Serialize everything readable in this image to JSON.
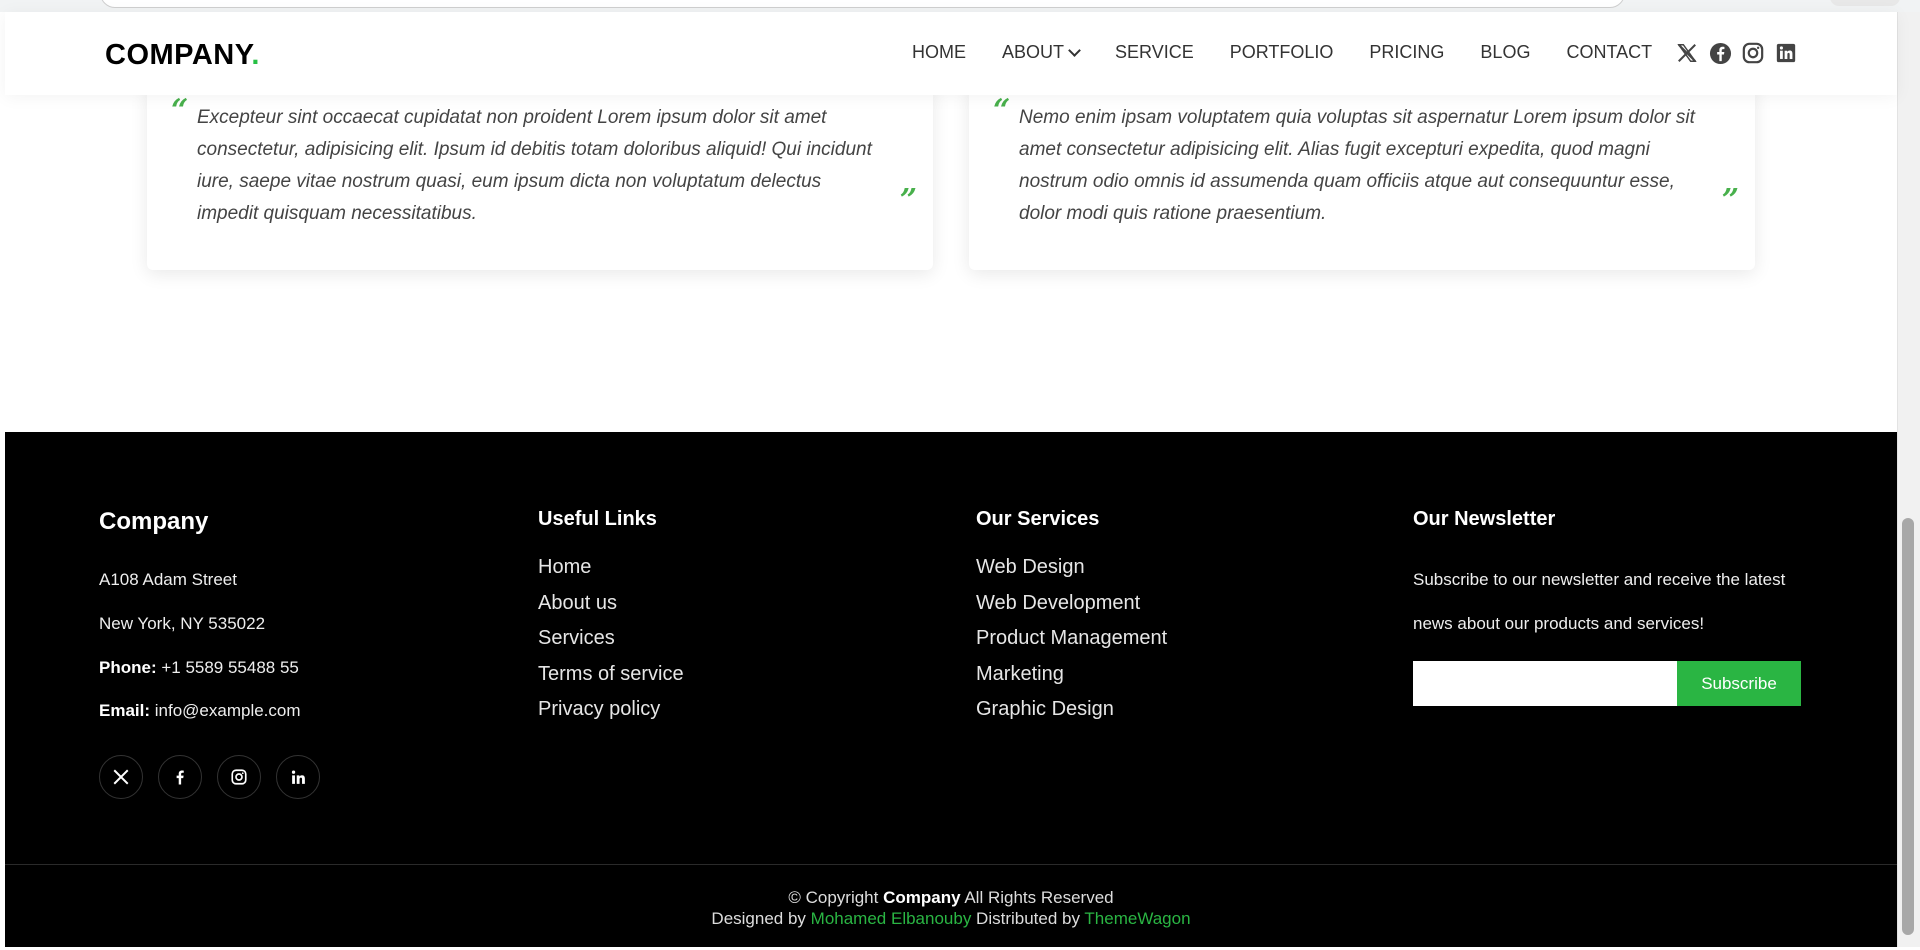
{
  "header": {
    "logo": "COMPANY",
    "logo_dot": ".",
    "nav": [
      "HOME",
      "ABOUT",
      "SERVICE",
      "PORTFOLIO",
      "PRICING",
      "BLOG",
      "CONTACT"
    ],
    "social_icons": [
      "x-icon",
      "facebook-icon",
      "instagram-icon",
      "linkedin-icon"
    ]
  },
  "testimonials": [
    {
      "quote_open": "“",
      "text": "Excepteur sint occaecat cupidatat non proident Lorem ipsum dolor sit amet consectetur, adipisicing elit. Ipsum id debitis totam doloribus aliquid! Qui incidunt iure, saepe vitae nostrum quasi, eum ipsum dicta non voluptatum delectus impedit quisquam necessitatibus.",
      "quote_close": "”"
    },
    {
      "quote_open": "“",
      "text": "Nemo enim ipsam voluptatem quia voluptas sit aspernatur Lorem ipsum dolor sit amet consectetur adipisicing elit. Alias fugit excepturi expedita, quod magni nostrum odio omnis id assumenda quam officiis atque aut consequuntur esse, dolor modi quis ratione praesentium.",
      "quote_close": "”"
    }
  ],
  "footer": {
    "company": {
      "title": "Company",
      "street": "A108 Adam Street",
      "city": "New York, NY 535022",
      "phone_label": "Phone:",
      "phone": " +1 5589 55488 55",
      "email_label": "Email:",
      "email": " info@example.com"
    },
    "useful_links": {
      "title": "Useful Links",
      "items": [
        "Home",
        "About us",
        "Services",
        "Terms of service",
        "Privacy policy"
      ]
    },
    "services": {
      "title": "Our Services",
      "items": [
        "Web Design",
        "Web Development",
        "Product Management",
        "Marketing",
        "Graphic Design"
      ]
    },
    "newsletter": {
      "title": "Our Newsletter",
      "text": "Subscribe to our newsletter and receive the latest news about our products and services!",
      "input_value": "",
      "button": "Subscribe"
    },
    "social_icons": [
      "x-icon",
      "facebook-icon",
      "instagram-icon",
      "linkedin-icon"
    ],
    "copyright_prefix": "© Copyright ",
    "copyright_brand": "Company",
    "copyright_suffix": " All Rights Reserved",
    "designed_by_prefix": "Designed by ",
    "designer": "Mohamed Elbanouby",
    "distributed_by_prefix": " Distributed by ",
    "distributor": "ThemeWagon"
  },
  "colors": {
    "accent": "#2ab543",
    "footer_bg": "#000000"
  }
}
